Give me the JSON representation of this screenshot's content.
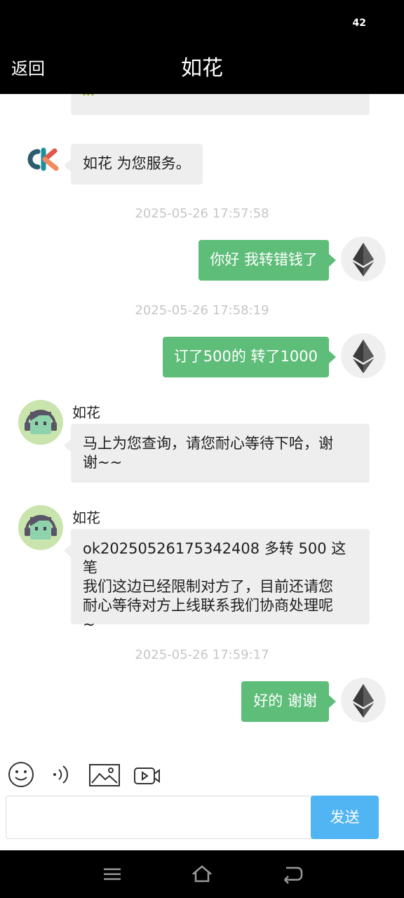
{
  "status_bar": {
    "battery": "42"
  },
  "header": {
    "back_label": "返回",
    "title": "如花"
  },
  "messages": {
    "partial_top": {
      "text": "m"
    },
    "system_welcome": {
      "text": "如花 为您服务。"
    },
    "ts1": "2025-05-26 17:57:58",
    "out1": "你好 我转错钱了",
    "ts2": "2025-05-26 17:58:19",
    "out2": "订了500的 转了1000",
    "agent1": {
      "name": "如花",
      "line1": "马上为您查询，请您耐心等待下哈，谢",
      "line2": "谢~~"
    },
    "agent2": {
      "name": "如花",
      "line1": "ok20250526175342408 多转 500 这笔",
      "line2": "我们这边已经限制对方了，目前还请您",
      "line3": "耐心等待对方上线联系我们协商处理呢",
      "line4": "~"
    },
    "ts3": "2025-05-26 17:59:17",
    "out3": "好的 谢谢"
  },
  "toolbar": {
    "icons": [
      "emoji-icon",
      "voice-icon",
      "image-icon",
      "video-icon"
    ]
  },
  "composer": {
    "input_value": "",
    "send_label": "发送"
  },
  "colors": {
    "outgoing_bubble": "#5ebd79",
    "incoming_bubble": "#eeeeee",
    "send_button": "#51b5f3",
    "timestamp": "#c6c6c6",
    "bars": "#000000"
  }
}
